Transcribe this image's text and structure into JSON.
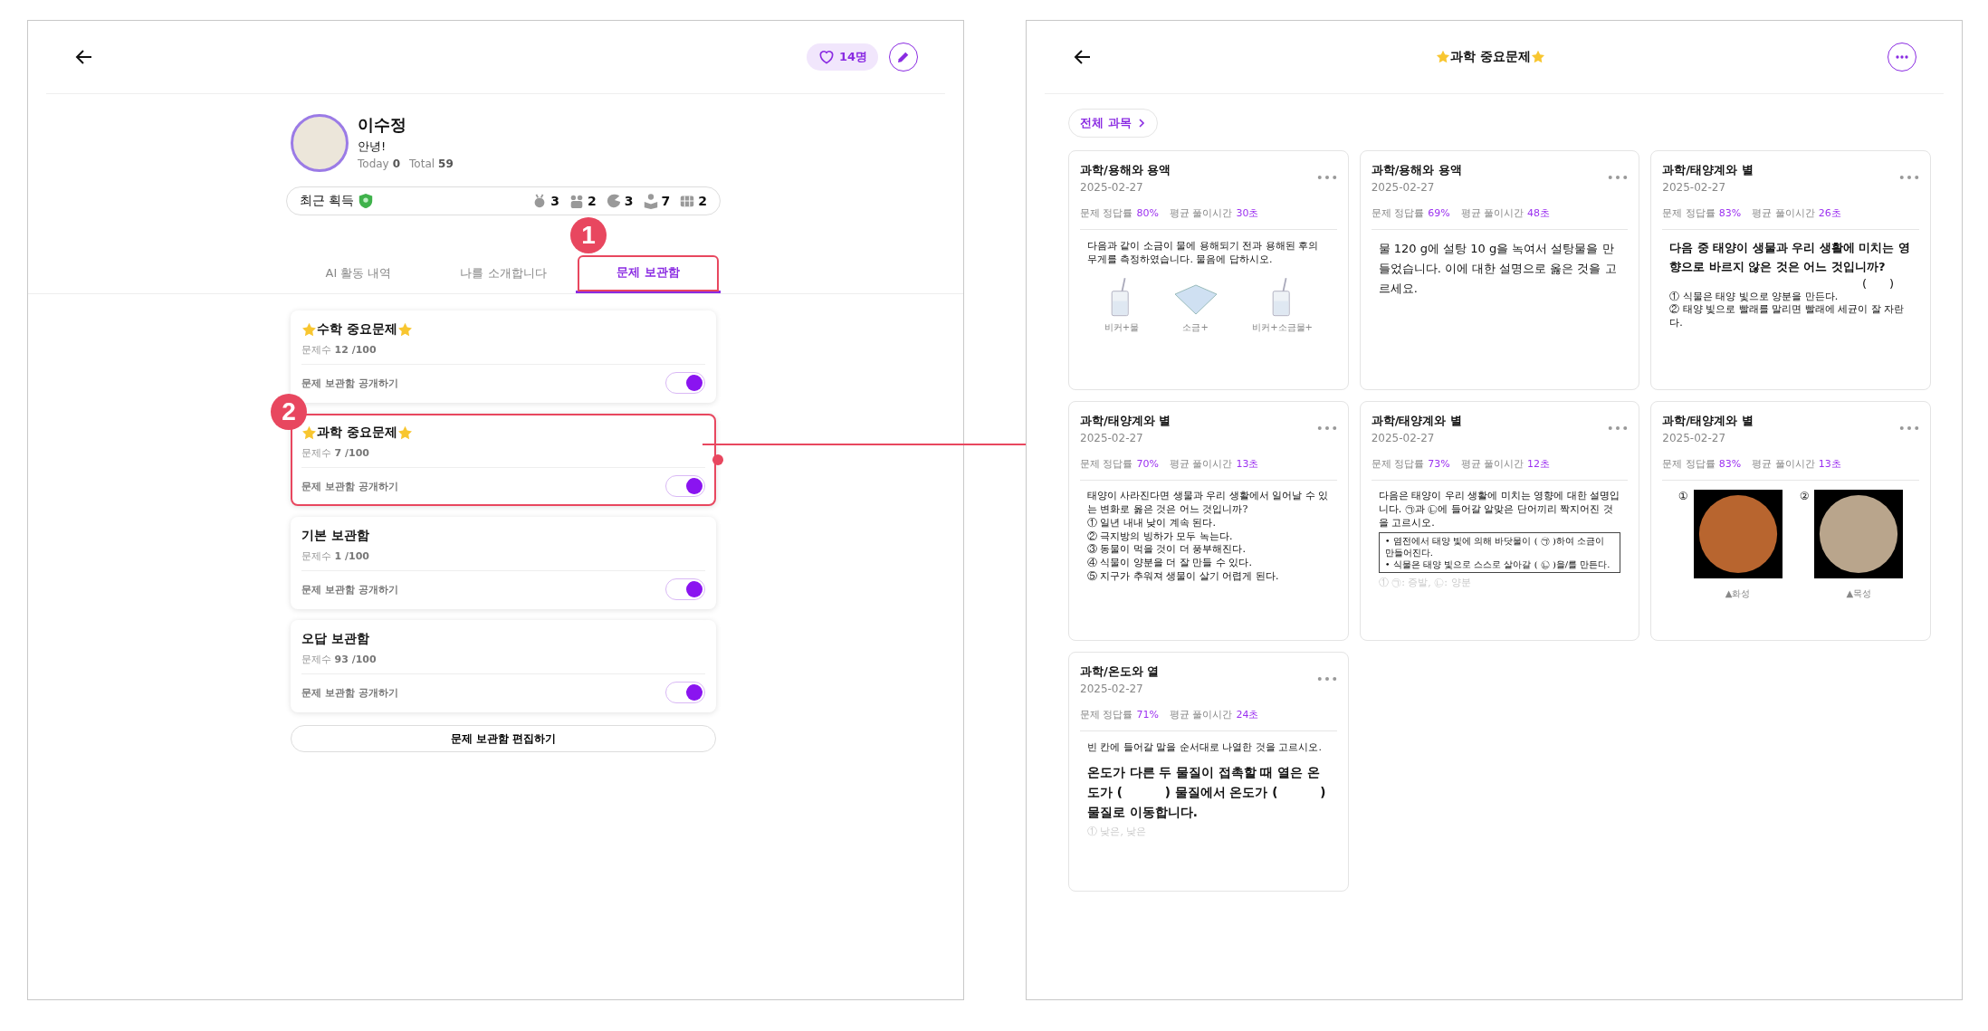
{
  "profile_screen": {
    "likes": "14명",
    "profile": {
      "name": "이수정",
      "status": "안녕!",
      "today_label": "Today",
      "today": "0",
      "total_label": "Total",
      "total": "59"
    },
    "recent": {
      "label": "최근 획득",
      "badges": [
        {
          "kind": "medal",
          "count": "3"
        },
        {
          "kind": "group",
          "count": "2"
        },
        {
          "kind": "moon",
          "count": "3"
        },
        {
          "kind": "reader",
          "count": "7"
        },
        {
          "kind": "grid",
          "count": "2"
        }
      ]
    },
    "tabs": [
      {
        "label": "AI 활동 내역",
        "selected": false
      },
      {
        "label": "나를 소개합니다",
        "selected": false
      },
      {
        "label": "문제 보관함",
        "selected": true,
        "callout": "1"
      }
    ],
    "boxes": [
      {
        "title": "수학 중요문제",
        "starred": true,
        "count_label": "문제수",
        "count": "12 /100",
        "toggle_label": "문제 보관함 공개하기",
        "on": true
      },
      {
        "title": "과학 중요문제",
        "starred": true,
        "count_label": "문제수",
        "count": "7 /100",
        "toggle_label": "문제 보관함 공개하기",
        "on": true,
        "callout": "2"
      },
      {
        "title": "기본 보관함",
        "starred": false,
        "count_label": "문제수",
        "count": "1 /100",
        "toggle_label": "문제 보관함 공개하기",
        "on": true
      },
      {
        "title": "오답 보관함",
        "starred": false,
        "count_label": "문제수",
        "count": "93 /100",
        "toggle_label": "문제 보관함 공개하기",
        "on": true
      }
    ],
    "edit_button": "문제 보관함 편집하기"
  },
  "box_screen": {
    "title": "과학 중요문제",
    "starred": true,
    "filter": "전체 과목",
    "questions": [
      {
        "subject": "과학/용해와 용액",
        "date": "2025-02-27",
        "rate_label": "문제 정답률",
        "rate": "80%",
        "time_label": "평균 풀이시간",
        "time": "30초",
        "preview": [
          {
            "kind": "small",
            "text": "다음과 같이 소금이 물에 용해되기 전과 용해된 후의 무게를 측정하였습니다. 물음에 답하시오."
          },
          {
            "kind": "beakers",
            "labels": [
              "비커+물",
              "소금+",
              "비커+소금물+"
            ]
          }
        ]
      },
      {
        "subject": "과학/용해와 용액",
        "date": "2025-02-27",
        "rate_label": "문제 정답률",
        "rate": "69%",
        "time_label": "평균 풀이시간",
        "time": "48초",
        "preview": [
          {
            "kind": "plain",
            "text": "물 120 g에 설탕 10 g을 녹여서 설탕물을 만들었습니다. 이에 대한 설명으로 옳은 것을 고르세요."
          }
        ]
      },
      {
        "subject": "과학/태양계와 별",
        "date": "2025-02-27",
        "rate_label": "문제 정답률",
        "rate": "83%",
        "time_label": "평균 풀이시간",
        "time": "26초",
        "preview": [
          {
            "kind": "bold",
            "text": "다음 중 태양이 생물과 우리 생활에 미치는 영향으로 바르지 않은 것은 어느 것입니까?"
          },
          {
            "kind": "blank",
            "text": "(      )"
          },
          {
            "kind": "options",
            "items": [
              "① 식물은 태양 빛으로 양분을 만든다.",
              "② 태양 빛으로 빨래를 말리면 빨래에 세균이 잘 자란다."
            ]
          }
        ]
      },
      {
        "subject": "과학/태양계와 별",
        "date": "2025-02-27",
        "rate_label": "문제 정답률",
        "rate": "70%",
        "time_label": "평균 풀이시간",
        "time": "13초",
        "preview": [
          {
            "kind": "serif",
            "text": "태양이 사라진다면 생물과 우리 생활에서 일어날 수 있는 변화로 옳은 것은 어느 것입니까?"
          },
          {
            "kind": "options",
            "items": [
              "① 일년 내내 낮이 계속 된다.",
              "② 극지방의 빙하가 모두 녹는다.",
              "③ 동물이 먹을 것이 더 풍부해진다.",
              "④ 식물이 양분을 더 잘 만들 수 있다.",
              "⑤ 지구가 추워져 생물이 살기 어렵게 된다."
            ]
          }
        ]
      },
      {
        "subject": "과학/태양계와 별",
        "date": "2025-02-27",
        "rate_label": "문제 정답률",
        "rate": "73%",
        "time_label": "평균 풀이시간",
        "time": "12초",
        "preview": [
          {
            "kind": "serif",
            "text": "다음은 태양이 우리 생활에 미치는 영향에 대한 설명입니다. ㉠과 ㉡에 들어갈 알맞은 단어끼리 짝지어진 것을 고르시오."
          },
          {
            "kind": "boxed",
            "items": [
              "• 염전에서 태양 빛에 의해 바닷물이 ( ㉠ )하여 소금이 만들어진다.",
              "• 식물은 태양 빛으로 스스로 살아갈 ( ㉡ )을/를 만든다."
            ]
          },
          {
            "kind": "faded",
            "items": [
              "① ㉠: 증발, ㉡: 양분"
            ]
          }
        ]
      },
      {
        "subject": "과학/태양계와 별",
        "date": "2025-02-27",
        "rate_label": "문제 정답률",
        "rate": "83%",
        "time_label": "평균 풀이시간",
        "time": "13초",
        "preview": [
          {
            "kind": "planets",
            "items": [
              {
                "marker": "①",
                "caption": "▲화성",
                "color": "#b8652f"
              },
              {
                "marker": "②",
                "caption": "▲목성",
                "color": "#b9a58c"
              }
            ]
          }
        ]
      },
      {
        "subject": "과학/온도와 열",
        "date": "2025-02-27",
        "rate_label": "문제 정답률",
        "rate": "71%",
        "time_label": "평균 풀이시간",
        "time": "24초",
        "preview": [
          {
            "kind": "small",
            "text": "빈 칸에 들어갈 말을 순서대로 나열한 것을 고르시오."
          },
          {
            "kind": "large",
            "text": "온도가 다른 두 물질이 접촉할 때 열은 온도가 (          ) 물질에서 온도가 (          ) 물질로 이동합니다."
          },
          {
            "kind": "faded",
            "items": [
              "① 낮은, 낮은"
            ]
          }
        ]
      }
    ]
  }
}
